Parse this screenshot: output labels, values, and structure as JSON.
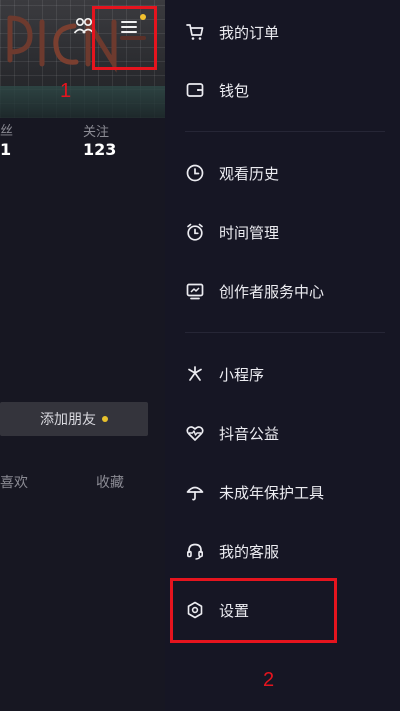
{
  "profile": {
    "stats": {
      "left_label": "丝",
      "left_value": "1",
      "following_label": "关注",
      "following_value": "123"
    },
    "add_friend_label": "添加朋友",
    "tabs": {
      "likes": "喜欢",
      "favorites": "收藏"
    }
  },
  "annotations": {
    "step1": "1",
    "step2": "2"
  },
  "menu": {
    "group1": [
      {
        "label": "我的订单",
        "icon": "cart-icon"
      },
      {
        "label": "钱包",
        "icon": "wallet-icon"
      }
    ],
    "group2": [
      {
        "label": "观看历史",
        "icon": "clock-icon"
      },
      {
        "label": "时间管理",
        "icon": "alarm-icon"
      },
      {
        "label": "创作者服务中心",
        "icon": "monitor-icon"
      }
    ],
    "group3": [
      {
        "label": "小程序",
        "icon": "asterisk-icon"
      },
      {
        "label": "抖音公益",
        "icon": "heart-pulse-icon"
      },
      {
        "label": "未成年保护工具",
        "icon": "umbrella-icon"
      },
      {
        "label": "我的客服",
        "icon": "headset-icon"
      },
      {
        "label": "设置",
        "icon": "hexagon-gear-icon"
      }
    ]
  },
  "colors": {
    "highlight": "#e5141e",
    "badge": "#f3c12e",
    "drawer_bg": "#161624"
  }
}
